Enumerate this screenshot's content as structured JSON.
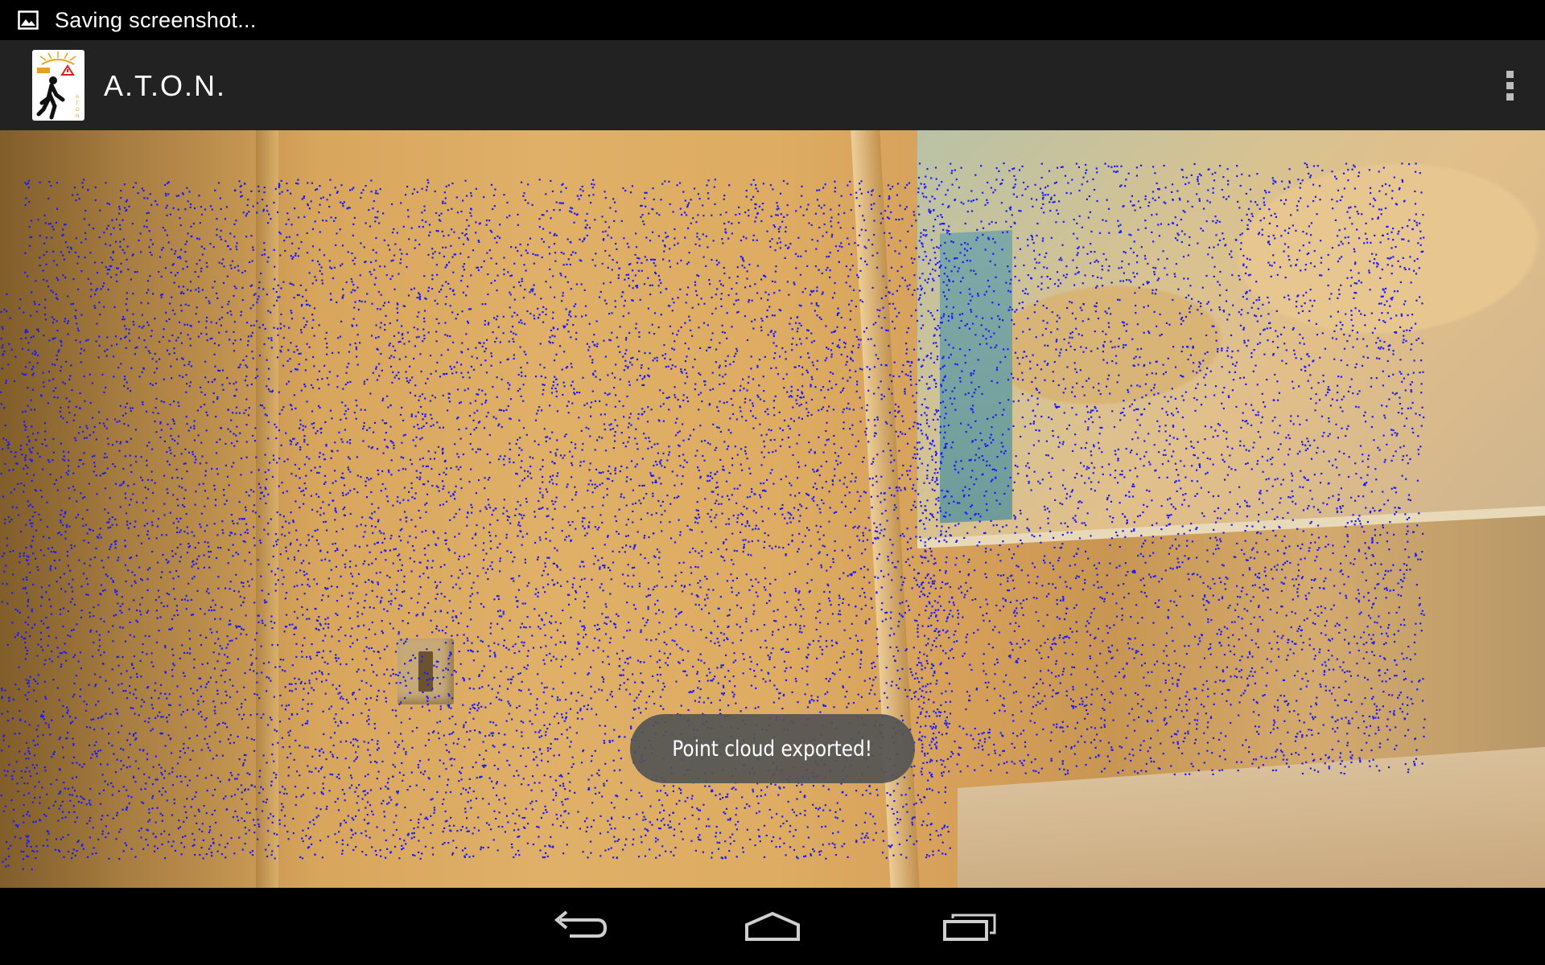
{
  "status_bar": {
    "notification_icon": "image-icon",
    "text": "Saving screenshot..."
  },
  "action_bar": {
    "app_icon": "pedestrian-warning-logo",
    "title": "A.T.O.N.",
    "overflow_icon": "overflow-menu-icon"
  },
  "camera": {
    "overlay": "point-cloud",
    "point_color": "#1a1aff"
  },
  "toast": {
    "message": "Point cloud exported!"
  },
  "nav_bar": {
    "back_icon": "back-icon",
    "home_icon": "home-icon",
    "recents_icon": "recent-apps-icon"
  }
}
